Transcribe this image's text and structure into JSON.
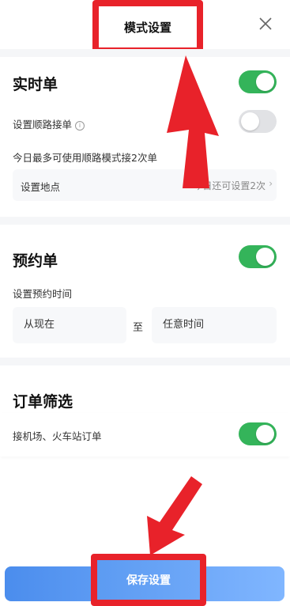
{
  "header": {
    "title": "模式设置",
    "close_icon": "close-icon"
  },
  "realtime": {
    "title": "实时单",
    "toggle_on": true,
    "route_label": "设置顺路接单",
    "route_toggle_on": false,
    "limit_text": "今日最多可使用顺路模式接2次单",
    "location_label": "设置地点",
    "location_value": "今日还可设置2次"
  },
  "reservation": {
    "title": "预约单",
    "toggle_on": true,
    "time_label": "设置预约时间",
    "from": "从现在",
    "to_sep": "至",
    "until": "任意时间"
  },
  "filter": {
    "title": "订单筛选",
    "option_label": "接机场、火车站订单",
    "toggle_on": true
  },
  "footer": {
    "save_label": "保存设置"
  },
  "colors": {
    "accent": "#34b45a",
    "button": "#4b8ded",
    "highlight": "#e8222a"
  }
}
